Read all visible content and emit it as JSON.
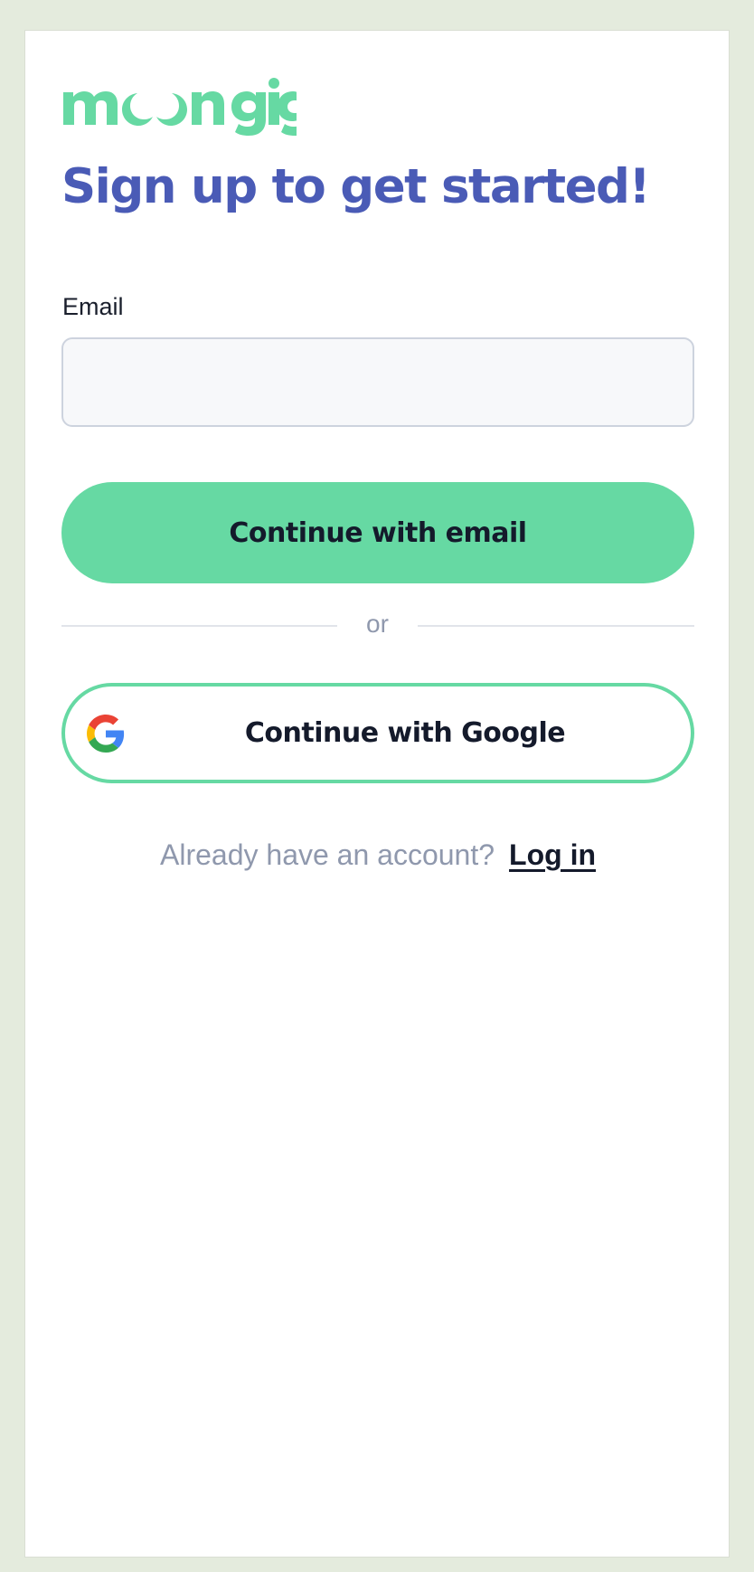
{
  "brand": {
    "name": "moongig",
    "color": "#66d9a3",
    "title_color": "#4a5bb6"
  },
  "page": {
    "title": "Sign up to get started!"
  },
  "form": {
    "email_label": "Email",
    "email_value": "",
    "email_placeholder": ""
  },
  "actions": {
    "continue_email": "Continue with email",
    "divider": "or",
    "continue_google": "Continue with Google",
    "google_icon": "google-logo-icon"
  },
  "footer": {
    "prompt": "Already have an account?",
    "login_link": "Log in"
  }
}
